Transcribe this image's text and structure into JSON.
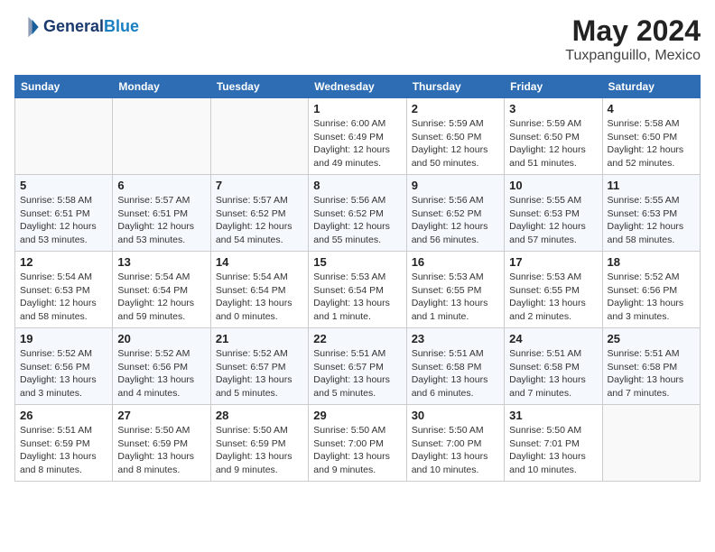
{
  "header": {
    "logo_line1": "General",
    "logo_line2": "Blue",
    "month_year": "May 2024",
    "location": "Tuxpanguillo, Mexico"
  },
  "weekdays": [
    "Sunday",
    "Monday",
    "Tuesday",
    "Wednesday",
    "Thursday",
    "Friday",
    "Saturday"
  ],
  "weeks": [
    [
      {
        "day": "",
        "info": ""
      },
      {
        "day": "",
        "info": ""
      },
      {
        "day": "",
        "info": ""
      },
      {
        "day": "1",
        "info": "Sunrise: 6:00 AM\nSunset: 6:49 PM\nDaylight: 12 hours\nand 49 minutes."
      },
      {
        "day": "2",
        "info": "Sunrise: 5:59 AM\nSunset: 6:50 PM\nDaylight: 12 hours\nand 50 minutes."
      },
      {
        "day": "3",
        "info": "Sunrise: 5:59 AM\nSunset: 6:50 PM\nDaylight: 12 hours\nand 51 minutes."
      },
      {
        "day": "4",
        "info": "Sunrise: 5:58 AM\nSunset: 6:50 PM\nDaylight: 12 hours\nand 52 minutes."
      }
    ],
    [
      {
        "day": "5",
        "info": "Sunrise: 5:58 AM\nSunset: 6:51 PM\nDaylight: 12 hours\nand 53 minutes."
      },
      {
        "day": "6",
        "info": "Sunrise: 5:57 AM\nSunset: 6:51 PM\nDaylight: 12 hours\nand 53 minutes."
      },
      {
        "day": "7",
        "info": "Sunrise: 5:57 AM\nSunset: 6:52 PM\nDaylight: 12 hours\nand 54 minutes."
      },
      {
        "day": "8",
        "info": "Sunrise: 5:56 AM\nSunset: 6:52 PM\nDaylight: 12 hours\nand 55 minutes."
      },
      {
        "day": "9",
        "info": "Sunrise: 5:56 AM\nSunset: 6:52 PM\nDaylight: 12 hours\nand 56 minutes."
      },
      {
        "day": "10",
        "info": "Sunrise: 5:55 AM\nSunset: 6:53 PM\nDaylight: 12 hours\nand 57 minutes."
      },
      {
        "day": "11",
        "info": "Sunrise: 5:55 AM\nSunset: 6:53 PM\nDaylight: 12 hours\nand 58 minutes."
      }
    ],
    [
      {
        "day": "12",
        "info": "Sunrise: 5:54 AM\nSunset: 6:53 PM\nDaylight: 12 hours\nand 58 minutes."
      },
      {
        "day": "13",
        "info": "Sunrise: 5:54 AM\nSunset: 6:54 PM\nDaylight: 12 hours\nand 59 minutes."
      },
      {
        "day": "14",
        "info": "Sunrise: 5:54 AM\nSunset: 6:54 PM\nDaylight: 13 hours\nand 0 minutes."
      },
      {
        "day": "15",
        "info": "Sunrise: 5:53 AM\nSunset: 6:54 PM\nDaylight: 13 hours\nand 1 minute."
      },
      {
        "day": "16",
        "info": "Sunrise: 5:53 AM\nSunset: 6:55 PM\nDaylight: 13 hours\nand 1 minute."
      },
      {
        "day": "17",
        "info": "Sunrise: 5:53 AM\nSunset: 6:55 PM\nDaylight: 13 hours\nand 2 minutes."
      },
      {
        "day": "18",
        "info": "Sunrise: 5:52 AM\nSunset: 6:56 PM\nDaylight: 13 hours\nand 3 minutes."
      }
    ],
    [
      {
        "day": "19",
        "info": "Sunrise: 5:52 AM\nSunset: 6:56 PM\nDaylight: 13 hours\nand 3 minutes."
      },
      {
        "day": "20",
        "info": "Sunrise: 5:52 AM\nSunset: 6:56 PM\nDaylight: 13 hours\nand 4 minutes."
      },
      {
        "day": "21",
        "info": "Sunrise: 5:52 AM\nSunset: 6:57 PM\nDaylight: 13 hours\nand 5 minutes."
      },
      {
        "day": "22",
        "info": "Sunrise: 5:51 AM\nSunset: 6:57 PM\nDaylight: 13 hours\nand 5 minutes."
      },
      {
        "day": "23",
        "info": "Sunrise: 5:51 AM\nSunset: 6:58 PM\nDaylight: 13 hours\nand 6 minutes."
      },
      {
        "day": "24",
        "info": "Sunrise: 5:51 AM\nSunset: 6:58 PM\nDaylight: 13 hours\nand 7 minutes."
      },
      {
        "day": "25",
        "info": "Sunrise: 5:51 AM\nSunset: 6:58 PM\nDaylight: 13 hours\nand 7 minutes."
      }
    ],
    [
      {
        "day": "26",
        "info": "Sunrise: 5:51 AM\nSunset: 6:59 PM\nDaylight: 13 hours\nand 8 minutes."
      },
      {
        "day": "27",
        "info": "Sunrise: 5:50 AM\nSunset: 6:59 PM\nDaylight: 13 hours\nand 8 minutes."
      },
      {
        "day": "28",
        "info": "Sunrise: 5:50 AM\nSunset: 6:59 PM\nDaylight: 13 hours\nand 9 minutes."
      },
      {
        "day": "29",
        "info": "Sunrise: 5:50 AM\nSunset: 7:00 PM\nDaylight: 13 hours\nand 9 minutes."
      },
      {
        "day": "30",
        "info": "Sunrise: 5:50 AM\nSunset: 7:00 PM\nDaylight: 13 hours\nand 10 minutes."
      },
      {
        "day": "31",
        "info": "Sunrise: 5:50 AM\nSunset: 7:01 PM\nDaylight: 13 hours\nand 10 minutes."
      },
      {
        "day": "",
        "info": ""
      }
    ]
  ]
}
